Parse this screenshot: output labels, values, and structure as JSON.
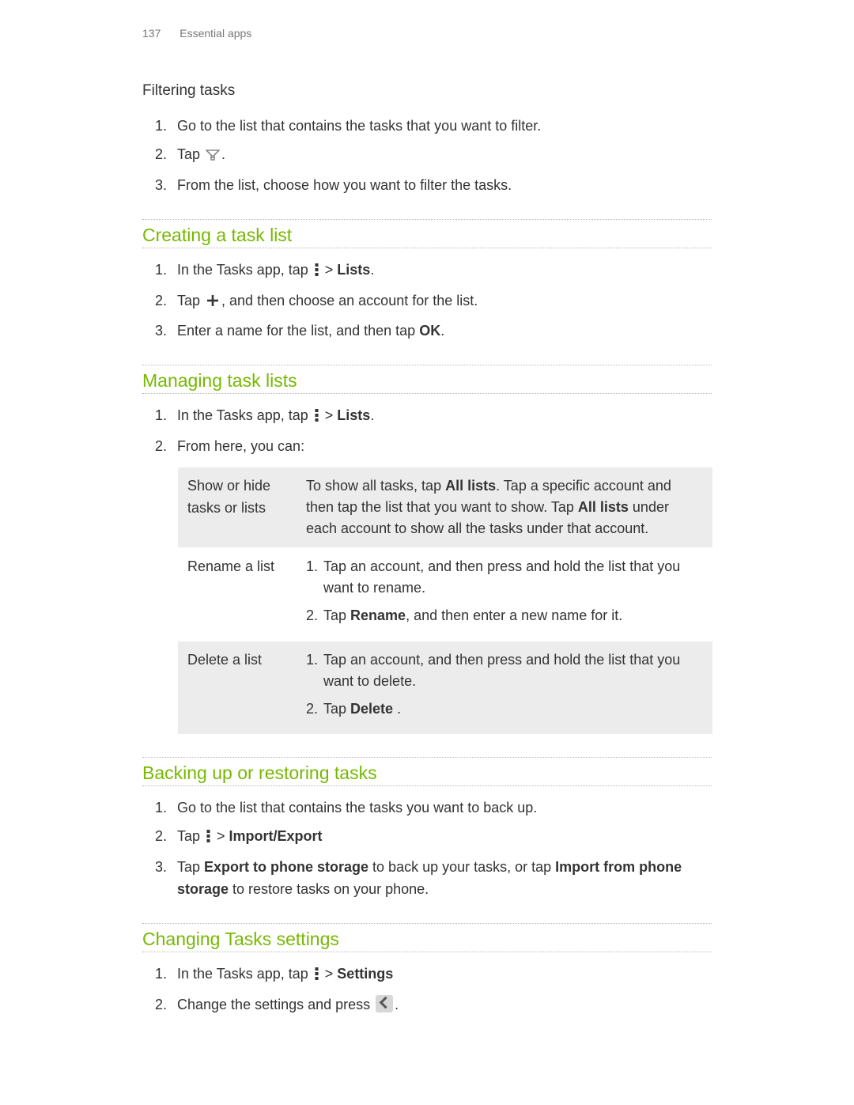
{
  "header": {
    "page_number": "137",
    "section": "Essential apps"
  },
  "filtering": {
    "title": "Filtering tasks",
    "steps": {
      "s1": "Go to the list that contains the tasks that you want to filter.",
      "s2a": "Tap ",
      "s2b": ".",
      "s3": "From the list, choose how you want to filter the tasks."
    }
  },
  "creating": {
    "title": "Creating a task list",
    "steps": {
      "s1a": "In the Tasks app, tap ",
      "s1b": " > ",
      "s1c": "Lists",
      "s1d": ".",
      "s2a": "Tap ",
      "s2b": ", and then choose an account for the list.",
      "s3a": "Enter a name for the list, and then tap ",
      "s3b": "OK",
      "s3c": "."
    }
  },
  "managing": {
    "title": "Managing task lists",
    "steps": {
      "s1a": "In the Tasks app, tap ",
      "s1b": " > ",
      "s1c": "Lists",
      "s1d": ".",
      "s2": "From here, you can:"
    },
    "table": {
      "r1": {
        "label": "Show or hide tasks or lists",
        "t1": "To show all tasks, tap ",
        "t2": "All lists",
        "t3": ". Tap a specific account and then tap the list that you want to show. Tap ",
        "t4": "All lists",
        "t5": " under each account to show all the tasks under that account."
      },
      "r2": {
        "label": "Rename a list",
        "i1": "Tap an account, and then press and hold the list that you want to rename.",
        "i2a": "Tap ",
        "i2b": "Rename",
        "i2c": ", and then enter a new name for it."
      },
      "r3": {
        "label": "Delete a list",
        "i1": "Tap an account, and then press and hold the list that you want to delete.",
        "i2a": "Tap ",
        "i2b": "Delete",
        "i2c": " ."
      }
    }
  },
  "backup": {
    "title": "Backing up or restoring tasks",
    "steps": {
      "s1": "Go to the list that contains the tasks you want to back up.",
      "s2a": "Tap ",
      "s2b": " > ",
      "s2c": "Import/Export",
      "s3a": "Tap ",
      "s3b": "Export to phone storage",
      "s3c": " to back up your tasks, or tap ",
      "s3d": "Import from phone storage",
      "s3e": " to restore tasks on your phone."
    }
  },
  "settings": {
    "title": "Changing Tasks settings",
    "steps": {
      "s1a": "In the Tasks app, tap ",
      "s1b": " > ",
      "s1c": "Settings",
      "s2a": "Change the settings and press ",
      "s2b": "."
    }
  }
}
